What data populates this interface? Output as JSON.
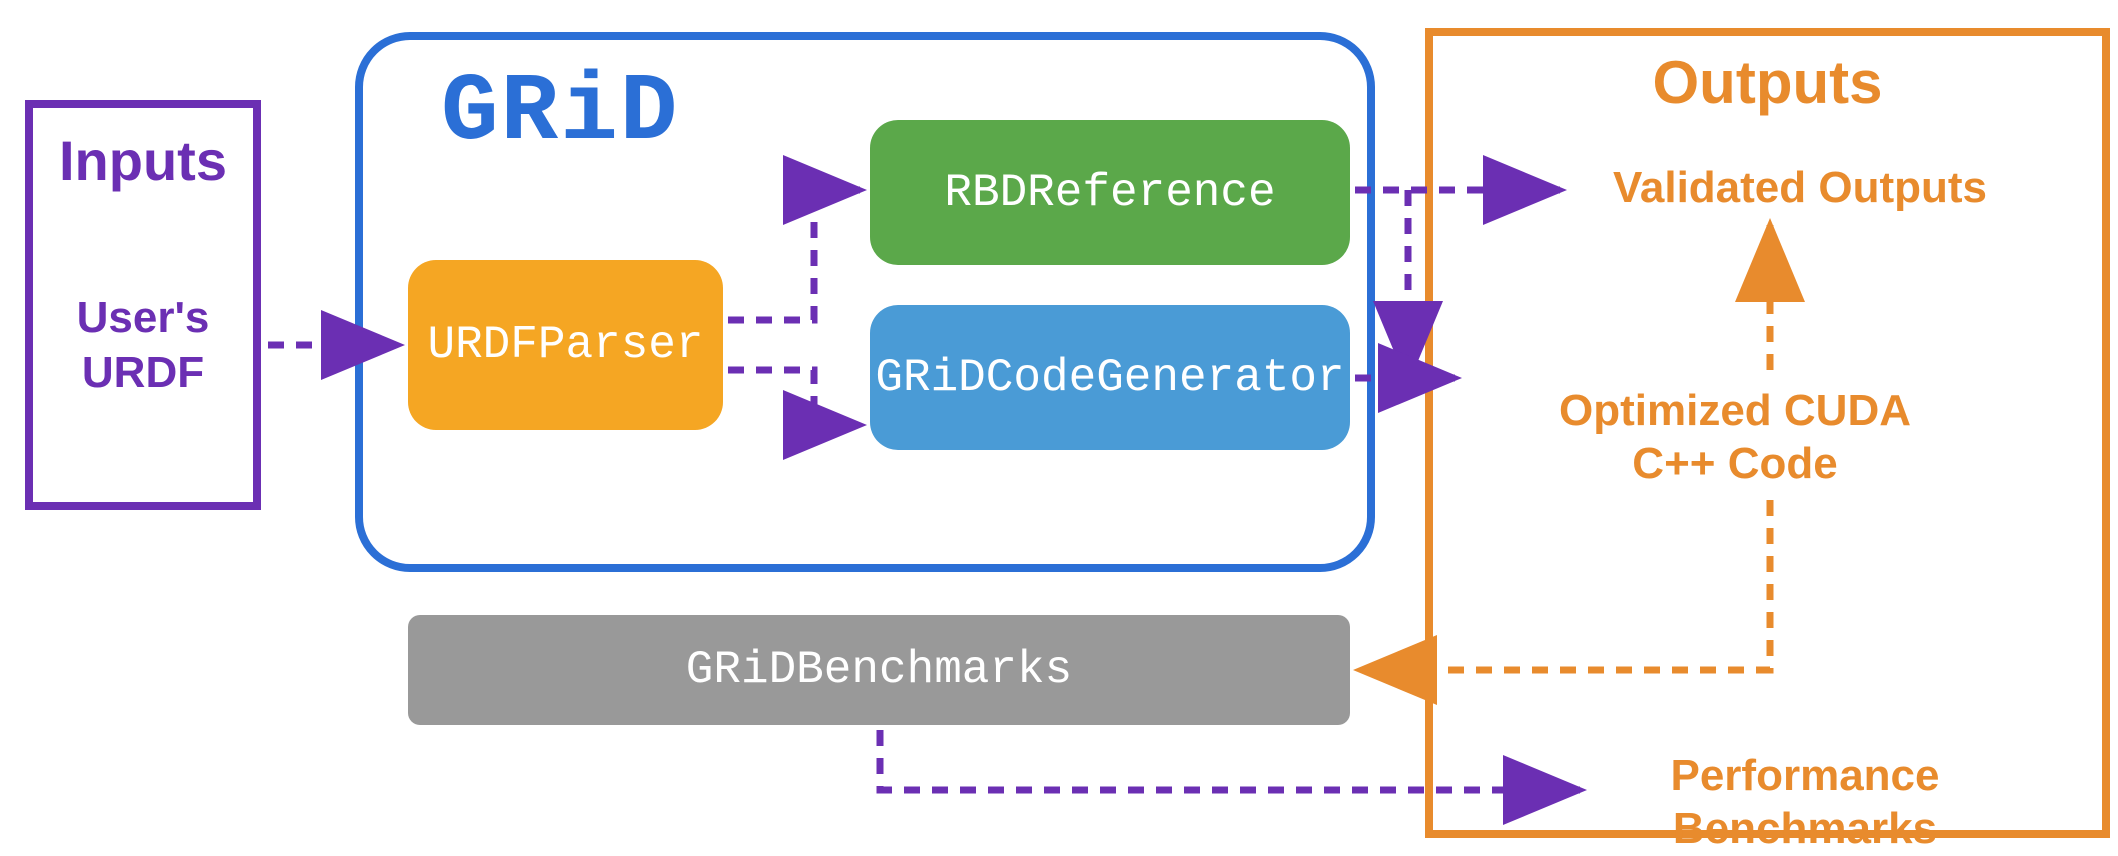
{
  "inputs": {
    "title": "Inputs",
    "text": "User's\nURDF"
  },
  "grid": {
    "title": "GRiD",
    "nodes": {
      "urdf_parser": "URDFParser",
      "rbd_reference": "RBDReference",
      "code_generator": "GRiDCodeGenerator",
      "benchmarks": "GRiDBenchmarks"
    }
  },
  "outputs": {
    "title": "Outputs",
    "validated": "Validated Outputs",
    "cuda": "Optimized CUDA\nC++ Code",
    "benchmarks": "Performance\nBenchmarks"
  },
  "colors": {
    "purple": "#6b2fb3",
    "blue": "#2b6fd6",
    "orange": "#e88b2d",
    "green": "#5ba84a",
    "light_blue": "#4a9bd6",
    "yellow": "#f5a623",
    "gray": "#999999"
  },
  "edges": [
    {
      "from": "inputs.user_urdf",
      "to": "grid.urdf_parser",
      "color": "purple"
    },
    {
      "from": "grid.urdf_parser",
      "to": "grid.rbd_reference",
      "color": "purple"
    },
    {
      "from": "grid.urdf_parser",
      "to": "grid.code_generator",
      "color": "purple"
    },
    {
      "from": "grid.rbd_reference",
      "to": "outputs.validated",
      "color": "purple"
    },
    {
      "from": "grid.code_generator",
      "to": "outputs.cuda",
      "color": "purple"
    },
    {
      "from": "grid.benchmarks",
      "to": "outputs.benchmarks",
      "color": "purple"
    },
    {
      "from": "outputs.cuda",
      "to": "outputs.validated",
      "color": "orange"
    },
    {
      "from": "outputs.cuda",
      "to": "grid.benchmarks",
      "color": "orange"
    }
  ]
}
